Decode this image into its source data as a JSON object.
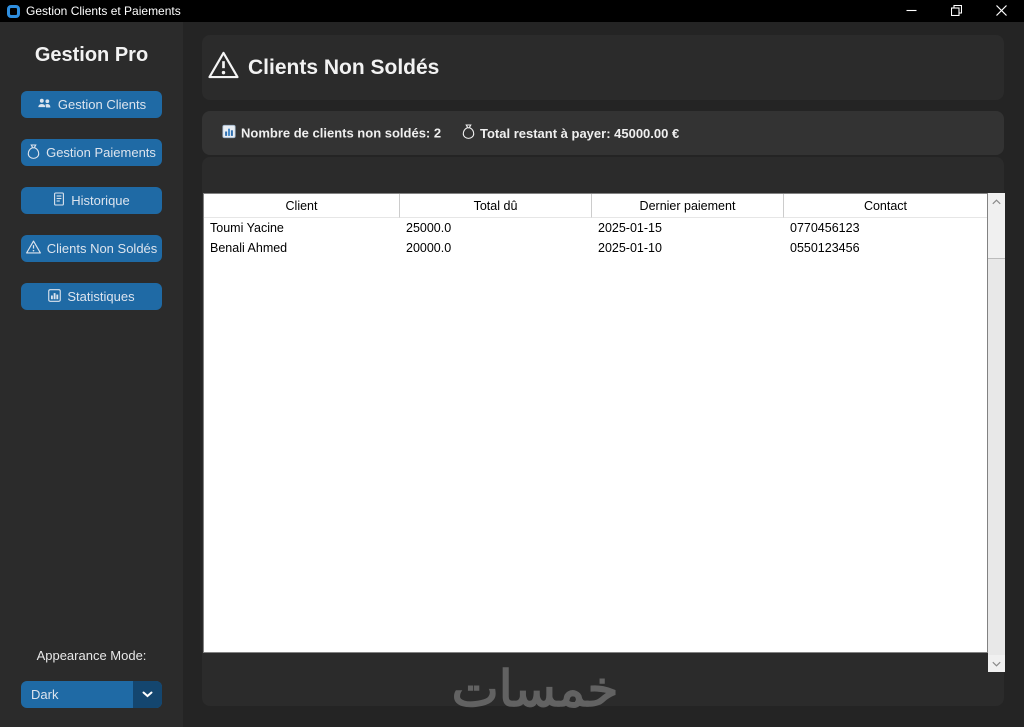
{
  "titlebar": {
    "app_icon": "app-logo-icon",
    "title": "Gestion Clients et Paiements",
    "controls": [
      {
        "name": "minimize",
        "icon": "minimize-icon"
      },
      {
        "name": "maximize-restore",
        "icon": "maximize-restore-icon"
      },
      {
        "name": "close",
        "icon": "close-icon"
      }
    ]
  },
  "sidebar": {
    "brand": "Gestion Pro",
    "items": [
      {
        "label": "Gestion Clients",
        "icon": "clients-icon"
      },
      {
        "label": "Gestion Paiements",
        "icon": "money-bag-icon"
      },
      {
        "label": "Historique",
        "icon": "receipt-icon"
      },
      {
        "label": "Clients Non Soldés",
        "icon": "warning-icon"
      },
      {
        "label": "Statistiques",
        "icon": "bar-chart-icon"
      }
    ],
    "appearance": {
      "label": "Appearance Mode:",
      "selected": "Dark",
      "icon": "chevron-down-icon"
    }
  },
  "main": {
    "title": "Clients Non Soldés",
    "title_icon": "warning-icon",
    "stats": [
      {
        "icon": "bar-chart-icon",
        "text": "Nombre de clients non soldés: 2"
      },
      {
        "icon": "money-bag-icon",
        "text": "Total restant à payer: 45000.00 €"
      }
    ],
    "table": {
      "columns": [
        "Client",
        "Total dû",
        "Dernier paiement",
        "Contact"
      ],
      "rows": [
        [
          "Toumi Yacine",
          "25000.0",
          "2025-01-15",
          "0770456123"
        ],
        [
          "Benali Ahmed",
          "20000.0",
          "2025-01-10",
          "0550123456"
        ]
      ]
    },
    "watermark": "خمسات"
  },
  "colors": {
    "accent": "#1f6aa5",
    "accent_dark": "#14466f",
    "root_bg": "#242424",
    "panel_bg": "#2b2b2b",
    "stats_panel_bg": "#333333",
    "titlebar_bg": "#000000",
    "table_bg": "#ffffff",
    "button_text": "#dce4ee"
  }
}
